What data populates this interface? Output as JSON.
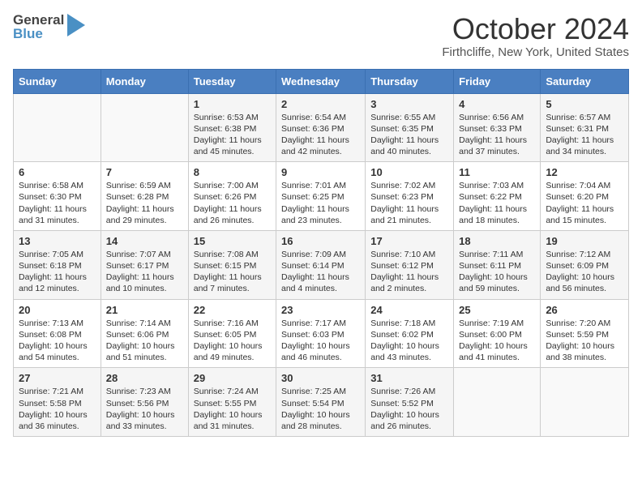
{
  "header": {
    "logo_general": "General",
    "logo_blue": "Blue",
    "month_title": "October 2024",
    "location": "Firthcliffe, New York, United States"
  },
  "days_of_week": [
    "Sunday",
    "Monday",
    "Tuesday",
    "Wednesday",
    "Thursday",
    "Friday",
    "Saturday"
  ],
  "weeks": [
    [
      {
        "day": "",
        "content": ""
      },
      {
        "day": "",
        "content": ""
      },
      {
        "day": "1",
        "content": "Sunrise: 6:53 AM\nSunset: 6:38 PM\nDaylight: 11 hours and 45 minutes."
      },
      {
        "day": "2",
        "content": "Sunrise: 6:54 AM\nSunset: 6:36 PM\nDaylight: 11 hours and 42 minutes."
      },
      {
        "day": "3",
        "content": "Sunrise: 6:55 AM\nSunset: 6:35 PM\nDaylight: 11 hours and 40 minutes."
      },
      {
        "day": "4",
        "content": "Sunrise: 6:56 AM\nSunset: 6:33 PM\nDaylight: 11 hours and 37 minutes."
      },
      {
        "day": "5",
        "content": "Sunrise: 6:57 AM\nSunset: 6:31 PM\nDaylight: 11 hours and 34 minutes."
      }
    ],
    [
      {
        "day": "6",
        "content": "Sunrise: 6:58 AM\nSunset: 6:30 PM\nDaylight: 11 hours and 31 minutes."
      },
      {
        "day": "7",
        "content": "Sunrise: 6:59 AM\nSunset: 6:28 PM\nDaylight: 11 hours and 29 minutes."
      },
      {
        "day": "8",
        "content": "Sunrise: 7:00 AM\nSunset: 6:26 PM\nDaylight: 11 hours and 26 minutes."
      },
      {
        "day": "9",
        "content": "Sunrise: 7:01 AM\nSunset: 6:25 PM\nDaylight: 11 hours and 23 minutes."
      },
      {
        "day": "10",
        "content": "Sunrise: 7:02 AM\nSunset: 6:23 PM\nDaylight: 11 hours and 21 minutes."
      },
      {
        "day": "11",
        "content": "Sunrise: 7:03 AM\nSunset: 6:22 PM\nDaylight: 11 hours and 18 minutes."
      },
      {
        "day": "12",
        "content": "Sunrise: 7:04 AM\nSunset: 6:20 PM\nDaylight: 11 hours and 15 minutes."
      }
    ],
    [
      {
        "day": "13",
        "content": "Sunrise: 7:05 AM\nSunset: 6:18 PM\nDaylight: 11 hours and 12 minutes."
      },
      {
        "day": "14",
        "content": "Sunrise: 7:07 AM\nSunset: 6:17 PM\nDaylight: 11 hours and 10 minutes."
      },
      {
        "day": "15",
        "content": "Sunrise: 7:08 AM\nSunset: 6:15 PM\nDaylight: 11 hours and 7 minutes."
      },
      {
        "day": "16",
        "content": "Sunrise: 7:09 AM\nSunset: 6:14 PM\nDaylight: 11 hours and 4 minutes."
      },
      {
        "day": "17",
        "content": "Sunrise: 7:10 AM\nSunset: 6:12 PM\nDaylight: 11 hours and 2 minutes."
      },
      {
        "day": "18",
        "content": "Sunrise: 7:11 AM\nSunset: 6:11 PM\nDaylight: 10 hours and 59 minutes."
      },
      {
        "day": "19",
        "content": "Sunrise: 7:12 AM\nSunset: 6:09 PM\nDaylight: 10 hours and 56 minutes."
      }
    ],
    [
      {
        "day": "20",
        "content": "Sunrise: 7:13 AM\nSunset: 6:08 PM\nDaylight: 10 hours and 54 minutes."
      },
      {
        "day": "21",
        "content": "Sunrise: 7:14 AM\nSunset: 6:06 PM\nDaylight: 10 hours and 51 minutes."
      },
      {
        "day": "22",
        "content": "Sunrise: 7:16 AM\nSunset: 6:05 PM\nDaylight: 10 hours and 49 minutes."
      },
      {
        "day": "23",
        "content": "Sunrise: 7:17 AM\nSunset: 6:03 PM\nDaylight: 10 hours and 46 minutes."
      },
      {
        "day": "24",
        "content": "Sunrise: 7:18 AM\nSunset: 6:02 PM\nDaylight: 10 hours and 43 minutes."
      },
      {
        "day": "25",
        "content": "Sunrise: 7:19 AM\nSunset: 6:00 PM\nDaylight: 10 hours and 41 minutes."
      },
      {
        "day": "26",
        "content": "Sunrise: 7:20 AM\nSunset: 5:59 PM\nDaylight: 10 hours and 38 minutes."
      }
    ],
    [
      {
        "day": "27",
        "content": "Sunrise: 7:21 AM\nSunset: 5:58 PM\nDaylight: 10 hours and 36 minutes."
      },
      {
        "day": "28",
        "content": "Sunrise: 7:23 AM\nSunset: 5:56 PM\nDaylight: 10 hours and 33 minutes."
      },
      {
        "day": "29",
        "content": "Sunrise: 7:24 AM\nSunset: 5:55 PM\nDaylight: 10 hours and 31 minutes."
      },
      {
        "day": "30",
        "content": "Sunrise: 7:25 AM\nSunset: 5:54 PM\nDaylight: 10 hours and 28 minutes."
      },
      {
        "day": "31",
        "content": "Sunrise: 7:26 AM\nSunset: 5:52 PM\nDaylight: 10 hours and 26 minutes."
      },
      {
        "day": "",
        "content": ""
      },
      {
        "day": "",
        "content": ""
      }
    ]
  ]
}
